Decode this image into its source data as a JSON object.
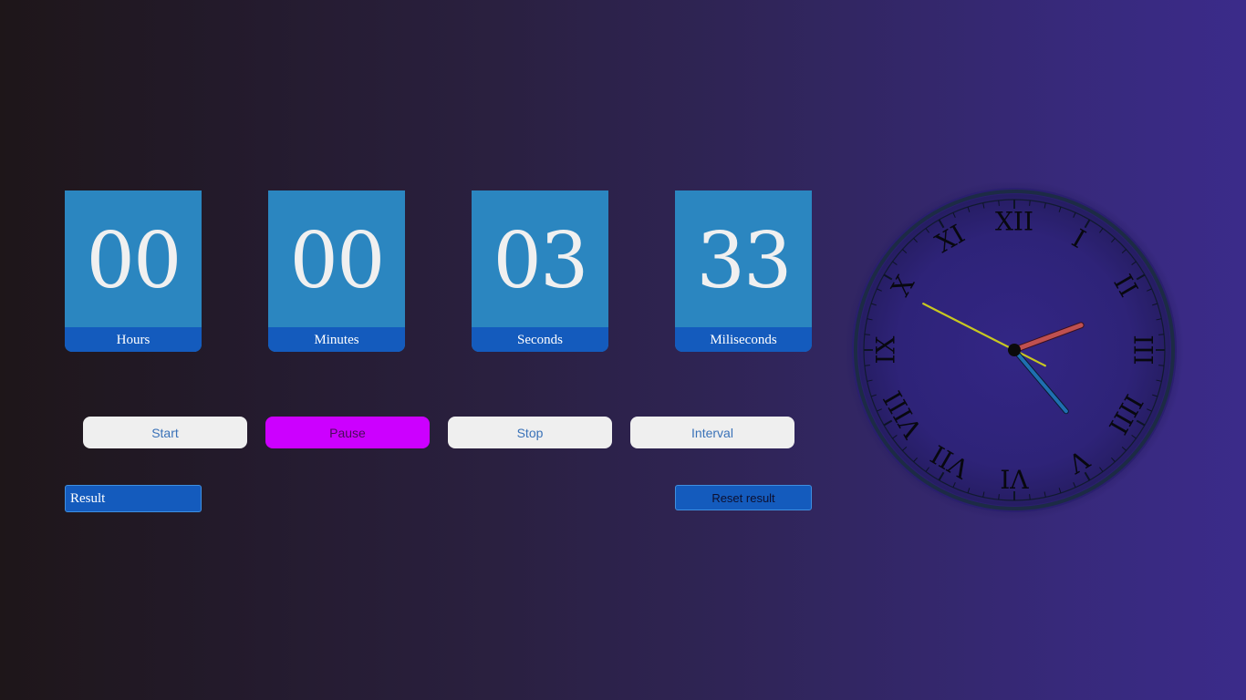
{
  "timer": {
    "hours": {
      "value": "00",
      "label": "Hours"
    },
    "minutes": {
      "value": "00",
      "label": "Minutes"
    },
    "seconds": {
      "value": "03",
      "label": "Seconds"
    },
    "milliseconds": {
      "value": "33",
      "label": "Miliseconds"
    }
  },
  "controls": {
    "start_label": "Start",
    "pause_label": "Pause",
    "stop_label": "Stop",
    "interval_label": "Interval"
  },
  "result": {
    "label": "Result",
    "reset_label": "Reset result"
  },
  "clock": {
    "numerals": [
      "XII",
      "I",
      "II",
      "III",
      "IIII",
      "V",
      "VI",
      "VII",
      "VIII",
      "IX",
      "X",
      "XI"
    ],
    "time": {
      "hour": 2.32,
      "minute": 23.3,
      "second": 49.5
    },
    "colors": {
      "hour_hand": "#c05050",
      "minute_hand": "#1f6fb0",
      "second_hand": "#c8c820",
      "face": "#2f237a",
      "rim": "#1c2b45"
    }
  },
  "colors": {
    "tile": "#2b86c0",
    "tile_label": "#145bbd",
    "active_button": "#cc00ff",
    "button": "#efefef"
  }
}
